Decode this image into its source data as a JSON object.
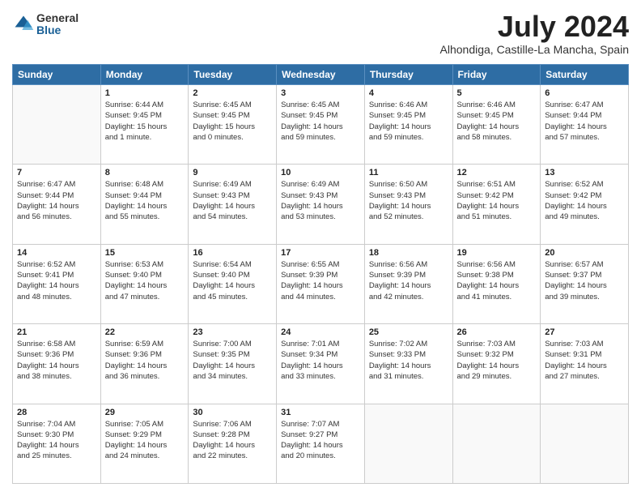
{
  "header": {
    "logo_general": "General",
    "logo_blue": "Blue",
    "month_title": "July 2024",
    "location": "Alhondiga, Castille-La Mancha, Spain"
  },
  "days_of_week": [
    "Sunday",
    "Monday",
    "Tuesday",
    "Wednesday",
    "Thursday",
    "Friday",
    "Saturday"
  ],
  "weeks": [
    [
      {
        "day": "",
        "info": ""
      },
      {
        "day": "1",
        "info": "Sunrise: 6:44 AM\nSunset: 9:45 PM\nDaylight: 15 hours\nand 1 minute."
      },
      {
        "day": "2",
        "info": "Sunrise: 6:45 AM\nSunset: 9:45 PM\nDaylight: 15 hours\nand 0 minutes."
      },
      {
        "day": "3",
        "info": "Sunrise: 6:45 AM\nSunset: 9:45 PM\nDaylight: 14 hours\nand 59 minutes."
      },
      {
        "day": "4",
        "info": "Sunrise: 6:46 AM\nSunset: 9:45 PM\nDaylight: 14 hours\nand 59 minutes."
      },
      {
        "day": "5",
        "info": "Sunrise: 6:46 AM\nSunset: 9:45 PM\nDaylight: 14 hours\nand 58 minutes."
      },
      {
        "day": "6",
        "info": "Sunrise: 6:47 AM\nSunset: 9:44 PM\nDaylight: 14 hours\nand 57 minutes."
      }
    ],
    [
      {
        "day": "7",
        "info": "Sunrise: 6:47 AM\nSunset: 9:44 PM\nDaylight: 14 hours\nand 56 minutes."
      },
      {
        "day": "8",
        "info": "Sunrise: 6:48 AM\nSunset: 9:44 PM\nDaylight: 14 hours\nand 55 minutes."
      },
      {
        "day": "9",
        "info": "Sunrise: 6:49 AM\nSunset: 9:43 PM\nDaylight: 14 hours\nand 54 minutes."
      },
      {
        "day": "10",
        "info": "Sunrise: 6:49 AM\nSunset: 9:43 PM\nDaylight: 14 hours\nand 53 minutes."
      },
      {
        "day": "11",
        "info": "Sunrise: 6:50 AM\nSunset: 9:43 PM\nDaylight: 14 hours\nand 52 minutes."
      },
      {
        "day": "12",
        "info": "Sunrise: 6:51 AM\nSunset: 9:42 PM\nDaylight: 14 hours\nand 51 minutes."
      },
      {
        "day": "13",
        "info": "Sunrise: 6:52 AM\nSunset: 9:42 PM\nDaylight: 14 hours\nand 49 minutes."
      }
    ],
    [
      {
        "day": "14",
        "info": "Sunrise: 6:52 AM\nSunset: 9:41 PM\nDaylight: 14 hours\nand 48 minutes."
      },
      {
        "day": "15",
        "info": "Sunrise: 6:53 AM\nSunset: 9:40 PM\nDaylight: 14 hours\nand 47 minutes."
      },
      {
        "day": "16",
        "info": "Sunrise: 6:54 AM\nSunset: 9:40 PM\nDaylight: 14 hours\nand 45 minutes."
      },
      {
        "day": "17",
        "info": "Sunrise: 6:55 AM\nSunset: 9:39 PM\nDaylight: 14 hours\nand 44 minutes."
      },
      {
        "day": "18",
        "info": "Sunrise: 6:56 AM\nSunset: 9:39 PM\nDaylight: 14 hours\nand 42 minutes."
      },
      {
        "day": "19",
        "info": "Sunrise: 6:56 AM\nSunset: 9:38 PM\nDaylight: 14 hours\nand 41 minutes."
      },
      {
        "day": "20",
        "info": "Sunrise: 6:57 AM\nSunset: 9:37 PM\nDaylight: 14 hours\nand 39 minutes."
      }
    ],
    [
      {
        "day": "21",
        "info": "Sunrise: 6:58 AM\nSunset: 9:36 PM\nDaylight: 14 hours\nand 38 minutes."
      },
      {
        "day": "22",
        "info": "Sunrise: 6:59 AM\nSunset: 9:36 PM\nDaylight: 14 hours\nand 36 minutes."
      },
      {
        "day": "23",
        "info": "Sunrise: 7:00 AM\nSunset: 9:35 PM\nDaylight: 14 hours\nand 34 minutes."
      },
      {
        "day": "24",
        "info": "Sunrise: 7:01 AM\nSunset: 9:34 PM\nDaylight: 14 hours\nand 33 minutes."
      },
      {
        "day": "25",
        "info": "Sunrise: 7:02 AM\nSunset: 9:33 PM\nDaylight: 14 hours\nand 31 minutes."
      },
      {
        "day": "26",
        "info": "Sunrise: 7:03 AM\nSunset: 9:32 PM\nDaylight: 14 hours\nand 29 minutes."
      },
      {
        "day": "27",
        "info": "Sunrise: 7:03 AM\nSunset: 9:31 PM\nDaylight: 14 hours\nand 27 minutes."
      }
    ],
    [
      {
        "day": "28",
        "info": "Sunrise: 7:04 AM\nSunset: 9:30 PM\nDaylight: 14 hours\nand 25 minutes."
      },
      {
        "day": "29",
        "info": "Sunrise: 7:05 AM\nSunset: 9:29 PM\nDaylight: 14 hours\nand 24 minutes."
      },
      {
        "day": "30",
        "info": "Sunrise: 7:06 AM\nSunset: 9:28 PM\nDaylight: 14 hours\nand 22 minutes."
      },
      {
        "day": "31",
        "info": "Sunrise: 7:07 AM\nSunset: 9:27 PM\nDaylight: 14 hours\nand 20 minutes."
      },
      {
        "day": "",
        "info": ""
      },
      {
        "day": "",
        "info": ""
      },
      {
        "day": "",
        "info": ""
      }
    ]
  ]
}
